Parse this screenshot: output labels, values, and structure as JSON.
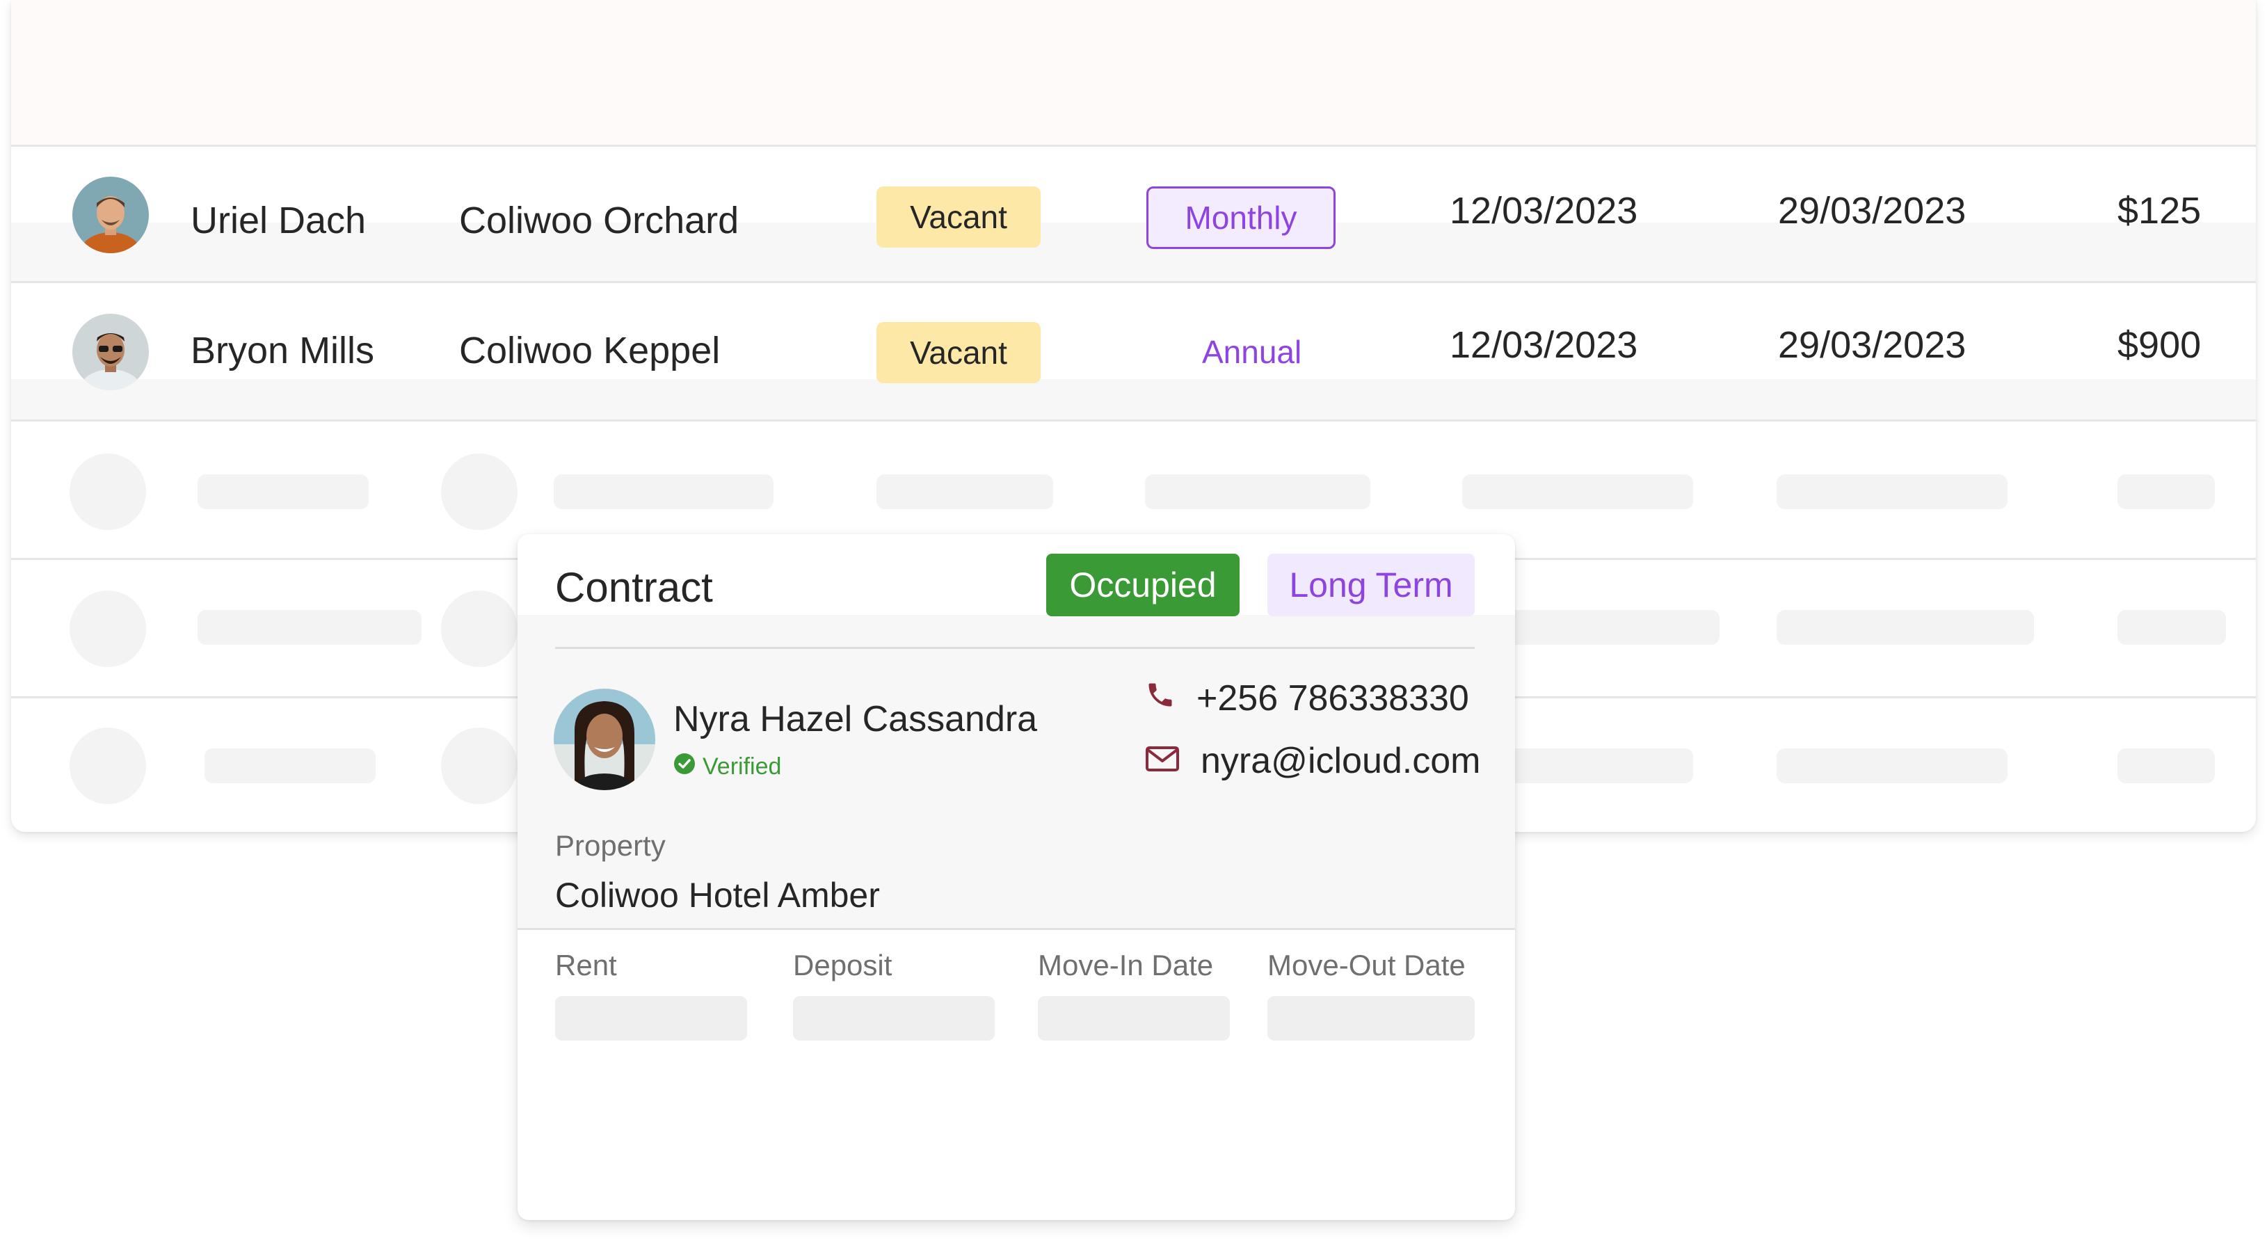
{
  "tenants": [
    {
      "name": "Uriel Dach",
      "property": "Coliwoo Orchard",
      "status": "Vacant",
      "plan": "Monthly",
      "move_in": "12/03/2023",
      "move_out": "29/03/2023",
      "rent": "$125"
    },
    {
      "name": "Bryon Mills",
      "property": "Coliwoo Keppel",
      "status": "Vacant",
      "plan": "Annual",
      "move_in": "12/03/2023",
      "move_out": "29/03/2023",
      "rent": "$900"
    }
  ],
  "contract": {
    "title": "Contract",
    "status_badge": "Occupied",
    "term_badge": "Long Term",
    "person": {
      "name": "Nyra Hazel Cassandra",
      "verified_label": "Verified"
    },
    "phone": "+256 786338330",
    "email": "nyra@icloud.com",
    "property_label": "Property",
    "property_value": "Coliwoo Hotel Amber",
    "fields": {
      "rent_label": "Rent",
      "deposit_label": "Deposit",
      "move_in_label": "Move-In Date",
      "move_out_label": "Move-Out Date"
    }
  },
  "colors": {
    "accent_purple": "#8e44e0",
    "occupied_green": "#3a9a35",
    "vacant_yellow": "#fde8a8",
    "icon_maroon": "#8a2a3a"
  },
  "icons": {
    "phone": "phone-icon",
    "mail": "mail-icon",
    "verified": "check-circle-icon"
  }
}
